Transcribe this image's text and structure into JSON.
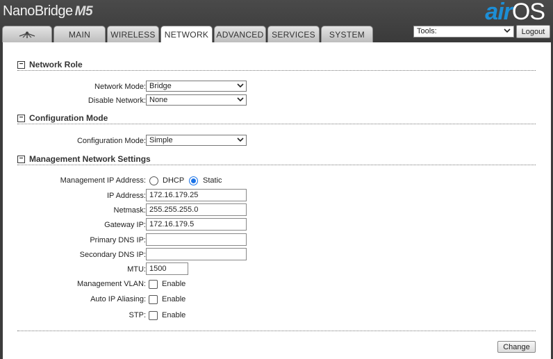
{
  "brand": {
    "name": "NanoBridge",
    "model": "M5",
    "logo_air": "air",
    "logo_os": "OS"
  },
  "tabs": [
    {
      "label": "",
      "icon": "ubiquiti-antenna-icon"
    },
    {
      "label": "MAIN"
    },
    {
      "label": "WIRELESS"
    },
    {
      "label": "NETWORK"
    },
    {
      "label": "ADVANCED"
    },
    {
      "label": "SERVICES"
    },
    {
      "label": "SYSTEM"
    }
  ],
  "active_tab": "NETWORK",
  "tools": {
    "value": "Tools:"
  },
  "logout_label": "Logout",
  "sections": {
    "network_role": {
      "title": "Network Role",
      "network_mode": {
        "label": "Network Mode:",
        "value": "Bridge"
      },
      "disable_network": {
        "label": "Disable Network:",
        "value": "None"
      }
    },
    "configuration_mode": {
      "title": "Configuration Mode",
      "configuration_mode": {
        "label": "Configuration Mode:",
        "value": "Simple"
      }
    },
    "management": {
      "title": "Management Network Settings",
      "mgmt_ip": {
        "label": "Management IP Address:",
        "dhcp": "DHCP",
        "static": "Static",
        "selected": "Static"
      },
      "ip_address": {
        "label": "IP Address:",
        "value": "172.16.179.25"
      },
      "netmask": {
        "label": "Netmask:",
        "value": "255.255.255.0"
      },
      "gateway": {
        "label": "Gateway IP:",
        "value": "172.16.179.5"
      },
      "primary_dns": {
        "label": "Primary DNS IP:",
        "value": ""
      },
      "secondary_dns": {
        "label": "Secondary DNS IP:",
        "value": ""
      },
      "mtu": {
        "label": "MTU:",
        "value": "1500"
      },
      "mgmt_vlan": {
        "label": "Management VLAN:",
        "option": "Enable",
        "checked": false
      },
      "auto_ip_alias": {
        "label": "Auto IP Aliasing:",
        "option": "Enable",
        "checked": false
      },
      "stp": {
        "label": "STP:",
        "option": "Enable",
        "checked": false
      }
    }
  },
  "change_label": "Change",
  "colors": {
    "header_bg": "#3c3c3c",
    "air_blue": "#1d8ed6",
    "radio_blue": "#1a73e8"
  }
}
